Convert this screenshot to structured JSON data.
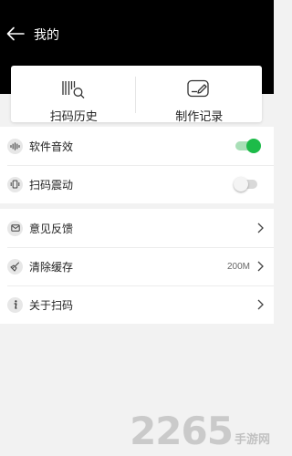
{
  "header": {
    "title": "我的"
  },
  "quick_actions": [
    {
      "label": "扫码历史",
      "icon": "scan-history-icon"
    },
    {
      "label": "制作记录",
      "icon": "create-record-icon"
    }
  ],
  "settings": {
    "sound_label": "软件音效",
    "sound_on": true,
    "vibrate_label": "扫码震动",
    "vibrate_on": false,
    "toggle_on_color": "#1dbb49"
  },
  "menu": {
    "feedback_label": "意见反馈",
    "clear_cache_label": "清除缓存",
    "cache_size": "200M",
    "about_label": "关于扫码"
  },
  "watermark": {
    "number": "2265",
    "text": "手游网"
  }
}
